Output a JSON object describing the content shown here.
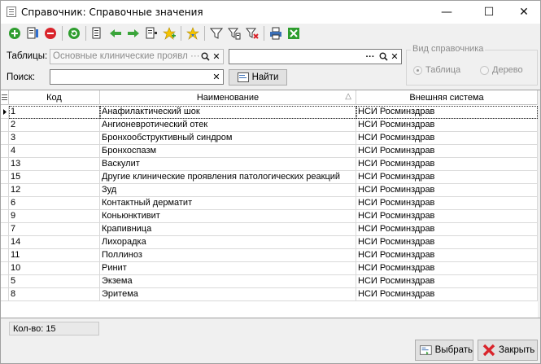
{
  "window": {
    "title": "Справочник: Справочные значения",
    "minimize_glyph": "—",
    "maximize_glyph": "☐",
    "close_glyph": "✕"
  },
  "toolbar": {
    "icons": [
      "add-icon",
      "edit-icon",
      "delete-icon",
      "refresh-icon",
      "copy-icon",
      "arrow-left-icon",
      "arrow-right-icon",
      "paste-icon",
      "add-star-icon",
      "favorite-icon",
      "filter-icon",
      "filter-edit-icon",
      "filter-clear-icon",
      "print-icon",
      "excel-icon"
    ]
  },
  "filters": {
    "tables_label": "Таблицы:",
    "tables_value": "Основные клинические проявл ···",
    "second_value": "",
    "second_dots": "···",
    "search_label": "Поиск:",
    "search_value": "",
    "find_button": "Найти",
    "view_group_title": "Вид справочника",
    "view_options": [
      "Таблица",
      "Дерево"
    ],
    "view_selected": "Таблица"
  },
  "grid": {
    "columns": [
      "Код",
      "Наименование",
      "Внешняя система"
    ],
    "sort_column": "Наименование",
    "sort_glyph": "△",
    "rows": [
      {
        "code": "1",
        "name": "Анафилактический шок",
        "system": "НСИ Росминздрав"
      },
      {
        "code": "2",
        "name": "Ангионевротический отек",
        "system": "НСИ Росминздрав"
      },
      {
        "code": "3",
        "name": "Бронхообструктивный синдром",
        "system": "НСИ Росминздрав"
      },
      {
        "code": "4",
        "name": "Бронхоспазм",
        "system": "НСИ Росминздрав"
      },
      {
        "code": "13",
        "name": "Васкулит",
        "system": "НСИ Росминздрав"
      },
      {
        "code": "15",
        "name": "Другие клинические проявления патологических реакций",
        "system": "НСИ Росминздрав"
      },
      {
        "code": "12",
        "name": "Зуд",
        "system": "НСИ Росминздрав"
      },
      {
        "code": "6",
        "name": "Контактный дерматит",
        "system": "НСИ Росминздрав"
      },
      {
        "code": "9",
        "name": "Коньюнктивит",
        "system": "НСИ Росминздрав"
      },
      {
        "code": "7",
        "name": "Крапивница",
        "system": "НСИ Росминздрав"
      },
      {
        "code": "14",
        "name": "Лихорадка",
        "system": "НСИ Росминздрав"
      },
      {
        "code": "11",
        "name": "Поллиноз",
        "system": "НСИ Росминздрав"
      },
      {
        "code": "10",
        "name": "Ринит",
        "system": "НСИ Росминздрав"
      },
      {
        "code": "5",
        "name": "Экзема",
        "system": "НСИ Росминздрав"
      },
      {
        "code": "8",
        "name": "Эритема",
        "system": "НСИ Росминздрав"
      }
    ]
  },
  "status": {
    "count_label": "Кол-во: 15"
  },
  "buttons": {
    "select": "Выбрать",
    "close": "Закрыть"
  },
  "colors": {
    "green": "#2e9d2e",
    "red": "#d9242b",
    "yellow": "#f5c400"
  }
}
